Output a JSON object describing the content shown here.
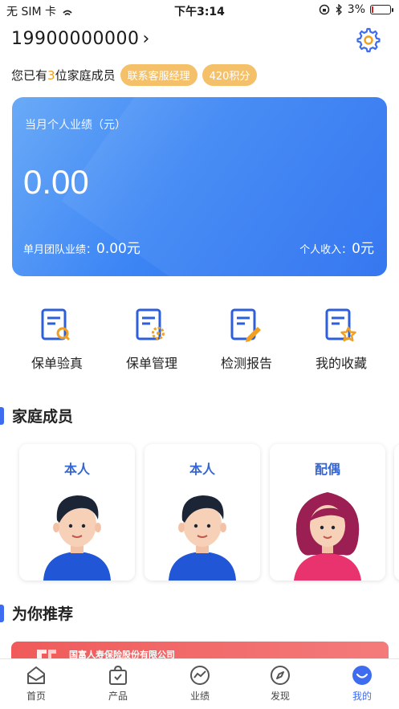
{
  "status_bar": {
    "carrier": "无 SIM 卡",
    "time": "下午3:14",
    "battery": "3%"
  },
  "header": {
    "phone": "19900000000",
    "member_prefix": "您已有",
    "member_count": "3",
    "member_suffix": "位家庭成员",
    "contact_manager": "联系客服经理",
    "points": "420积分"
  },
  "performance": {
    "title": "当月个人业绩（元）",
    "value": "0.00",
    "team_label": "单月团队业绩：",
    "team_value": "0.00元",
    "income_label": "个人收入：",
    "income_value": "0元"
  },
  "actions": [
    {
      "label": "保单验真",
      "icon": "policy-verify-icon"
    },
    {
      "label": "保单管理",
      "icon": "policy-manage-icon"
    },
    {
      "label": "检测报告",
      "icon": "report-icon"
    },
    {
      "label": "我的收藏",
      "icon": "favorite-icon"
    }
  ],
  "family": {
    "title": "家庭成员",
    "members": [
      {
        "role": "本人",
        "avatar": "male-avatar"
      },
      {
        "role": "本人",
        "avatar": "male-avatar"
      },
      {
        "role": "配偶",
        "avatar": "female-avatar"
      }
    ]
  },
  "recommend": {
    "title": "为你推荐",
    "banner_text": "国富人寿保险股份有限公司"
  },
  "tabs": [
    {
      "label": "首页",
      "icon": "home-icon"
    },
    {
      "label": "产品",
      "icon": "product-bag-icon"
    },
    {
      "label": "业绩",
      "icon": "performance-icon"
    },
    {
      "label": "发现",
      "icon": "compass-icon"
    },
    {
      "label": "我的",
      "icon": "profile-icon"
    }
  ],
  "colors": {
    "accent": "#3d6cf0",
    "pill": "#f4c16a",
    "card_blue": "#3d86f5",
    "banner_red": "#f05a5a"
  }
}
